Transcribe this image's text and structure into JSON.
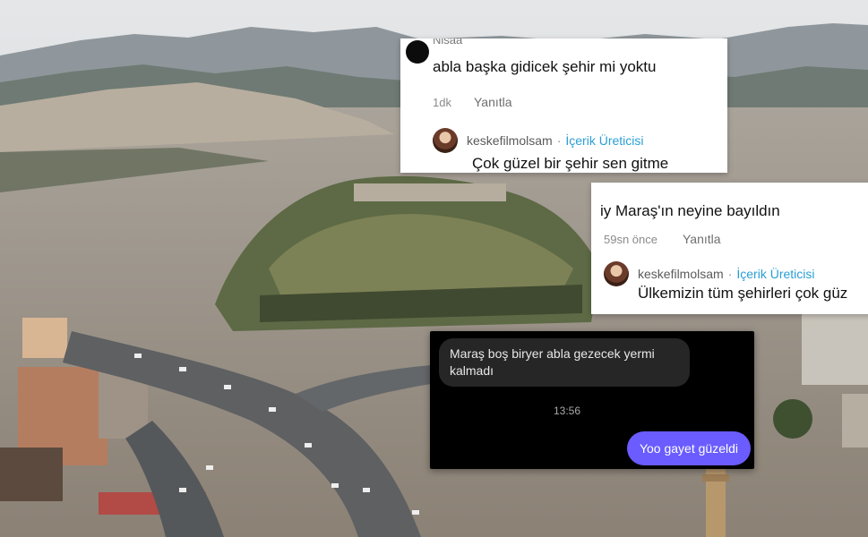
{
  "comment_1": {
    "author_clipped": "Nisaa",
    "text": "abla başka gidicek şehir mi yoktu",
    "time": "1dk",
    "reply_action": "Yanıtla",
    "reply": {
      "author": "keskefilmolsam",
      "separator": "·",
      "role": "İçerik Üreticisi",
      "text": "Çok güzel bir şehir sen gitme"
    }
  },
  "comment_2": {
    "text": "iy Maraş'ın neyine bayıldın",
    "time": "59sn önce",
    "reply_action": "Yanıtla",
    "reply": {
      "author": "keskefilmolsam",
      "separator": "·",
      "role": "İçerik Üreticisi",
      "text": "Ülkemizin tüm şehirleri çok güz"
    }
  },
  "dm": {
    "incoming": "Maraş boş biryer abla gezecek yermi kalmadı",
    "time": "13:56",
    "outgoing": "Yoo gayet güzeldi"
  },
  "colors": {
    "role_blue": "#2a9fd6",
    "dm_outgoing": "#6a5cff",
    "dm_incoming": "#262626"
  }
}
